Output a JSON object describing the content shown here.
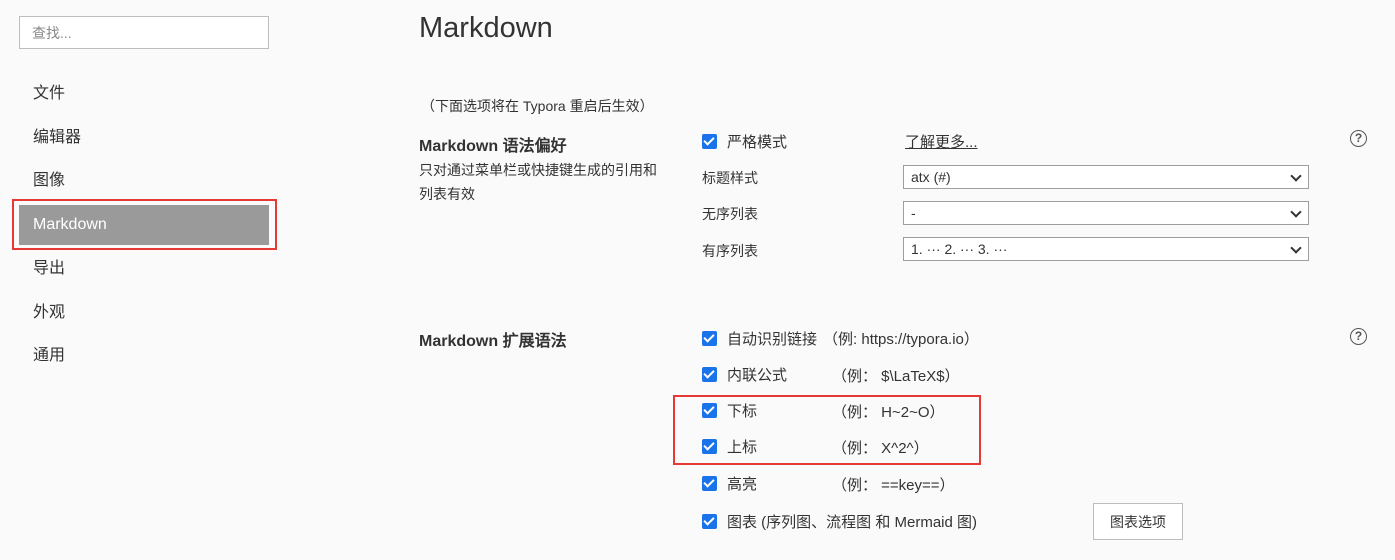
{
  "sidebar": {
    "search_placeholder": "查找...",
    "items": [
      {
        "label": "文件",
        "active": false
      },
      {
        "label": "编辑器",
        "active": false
      },
      {
        "label": "图像",
        "active": false
      },
      {
        "label": "Markdown",
        "active": true
      },
      {
        "label": "导出",
        "active": false
      },
      {
        "label": "外观",
        "active": false
      },
      {
        "label": "通用",
        "active": false
      }
    ]
  },
  "main": {
    "title": "Markdown",
    "restart_note": "（下面选项将在 Typora 重启后生效）",
    "syntax_pref": {
      "title": "Markdown 语法偏好",
      "description": "只对通过菜单栏或快捷键生成的引用和列表有效",
      "strict_mode_label": "严格模式",
      "strict_mode_checked": true,
      "learn_more": "了解更多...",
      "heading_style_label": "标题样式",
      "heading_style_value": "atx (#)",
      "unordered_list_label": "无序列表",
      "unordered_list_value": "-",
      "ordered_list_label": "有序列表",
      "ordered_list_value": "1. ··· 2. ··· 3. ···"
    },
    "ext_syntax": {
      "title": "Markdown 扩展语法",
      "options": [
        {
          "label": "自动识别链接",
          "example": "（例: https://typora.io）",
          "checked": true
        },
        {
          "label": "内联公式",
          "example": "（例： $\\LaTeX$）",
          "checked": true
        },
        {
          "label": "下标",
          "example": "（例： H~2~O）",
          "checked": true
        },
        {
          "label": "上标",
          "example": "（例： X^2^）",
          "checked": true
        },
        {
          "label": "高亮",
          "example": "（例： ==key==）",
          "checked": true
        },
        {
          "label": "图表 (序列图、流程图 和 Mermaid 图)",
          "example": "",
          "checked": true
        }
      ],
      "chart_options_button": "图表选项"
    },
    "help_icon_glyph": "?"
  },
  "colors": {
    "accent": "#1a73e8",
    "active_nav_bg": "#9a9a9a",
    "highlight_box": "#e53935"
  }
}
